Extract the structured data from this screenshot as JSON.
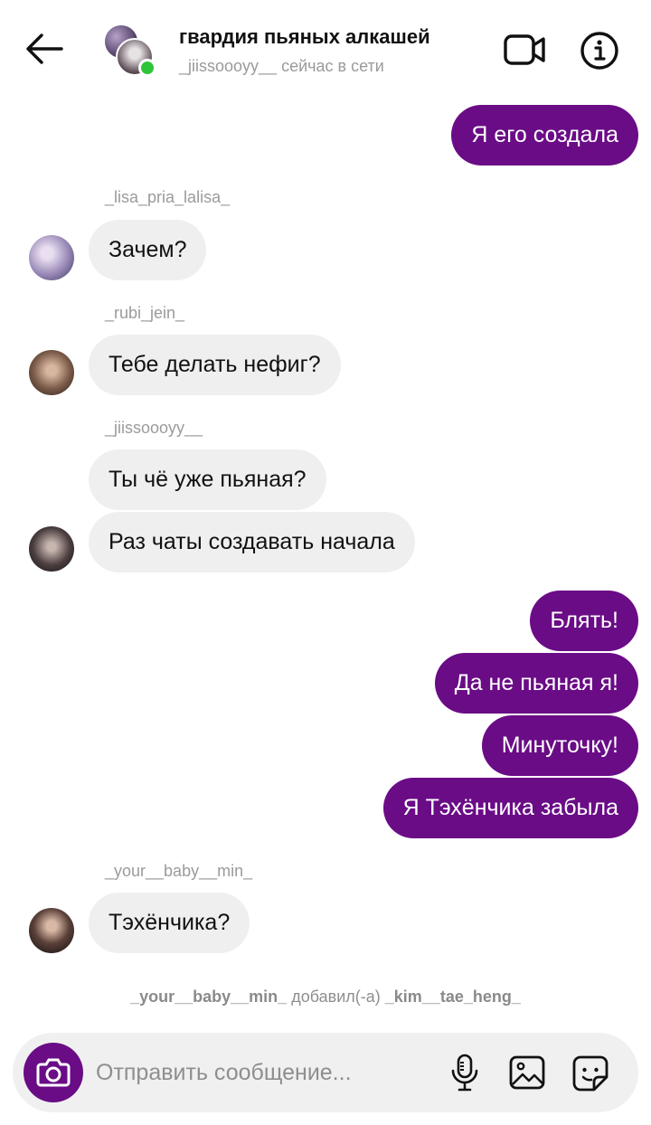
{
  "header": {
    "title": "гвардия пьяных алкашей",
    "status": "_jiissoooyy__ сейчас в сети",
    "icons": {
      "back": "arrow-left-icon",
      "video": "video-camera-icon",
      "info": "info-icon"
    },
    "online_color": "#2fc53a"
  },
  "messages": [
    {
      "direction": "out",
      "text": "Я его создала"
    },
    {
      "direction": "in",
      "sender": "_lisa_pria_lalisa_",
      "text": "Зачем?"
    },
    {
      "direction": "in",
      "sender": "_rubi_jein_",
      "text": "Тебе делать нефиг?"
    },
    {
      "direction": "in",
      "sender": "_jiissoooyy__",
      "text": "Ты чё уже пьяная?"
    },
    {
      "direction": "in",
      "text": "Раз чаты создавать начала"
    },
    {
      "direction": "out",
      "text": "Блять!"
    },
    {
      "direction": "out",
      "text": "Да не пьяная я!"
    },
    {
      "direction": "out",
      "text": "Минуточку!"
    },
    {
      "direction": "out",
      "text": "Я Тэхёнчика забыла"
    },
    {
      "direction": "in",
      "sender": "_your__baby__min_",
      "text": "Тэхёнчика?"
    }
  ],
  "system_note": {
    "actor": "_your__baby__min_",
    "action": "добавил(-а)",
    "target": "_kim__tae_heng_"
  },
  "composer": {
    "placeholder": "Отправить сообщение...",
    "value": "",
    "icons": {
      "camera": "camera-icon",
      "mic": "microphone-icon",
      "gallery": "gallery-icon",
      "sticker": "sticker-icon"
    }
  },
  "colors": {
    "accent": "#6a0c86",
    "incoming_bubble": "#efefef",
    "secondary_text": "#9b9b9b"
  }
}
